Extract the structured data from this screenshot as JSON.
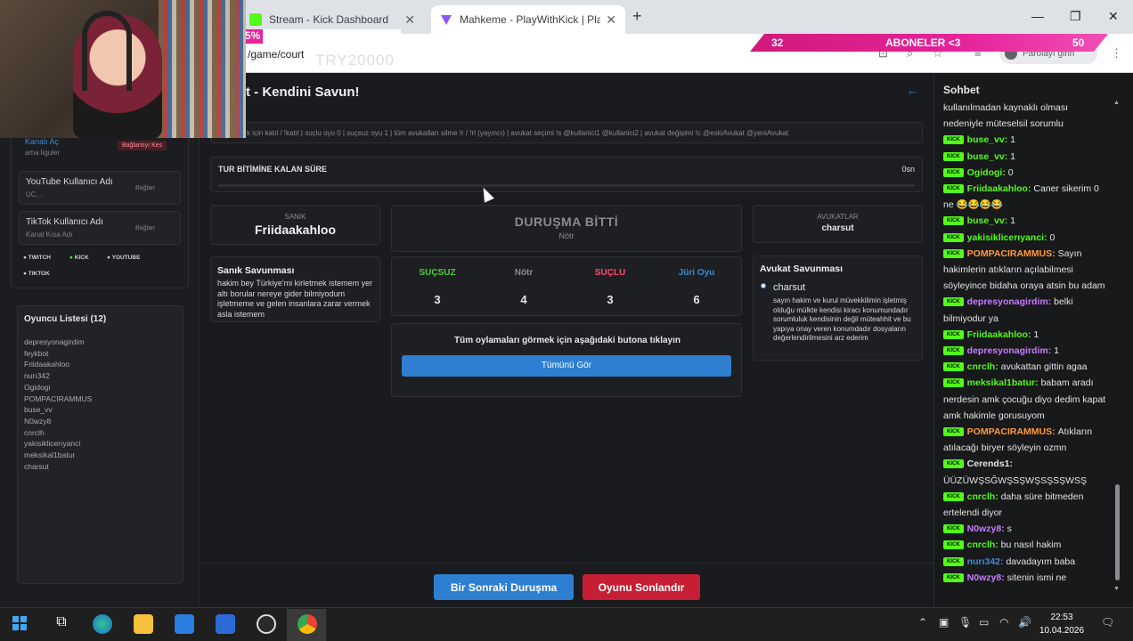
{
  "browser": {
    "tabs": [
      {
        "title": "Stream - Kick Dashboard",
        "active": false
      },
      {
        "title": "Mahkeme - PlayWithKick | Play",
        "active": true
      }
    ],
    "url": "/game/court",
    "profile_label": "Parolayı girin"
  },
  "overlay": {
    "goal_left": "32",
    "goal_text": "ABONELER <3",
    "goal_right": "50",
    "percent": "5%",
    "code": "TRY20000"
  },
  "left": {
    "open_channel": "Kanalı Aç",
    "open_channel_sub": "ama liguler",
    "disconnect_label": "Bağlantıyı Kes",
    "youtube_label": "YouTube Kullanıcı Adı",
    "youtube_placeholder": "UC...",
    "youtube_connect": "Bağlan",
    "tiktok_label": "TikTok Kullanıcı Adı",
    "tiktok_placeholder": "Kanal Kısa Adı",
    "tiktok_connect": "Bağlan",
    "platforms": [
      "TWITCH",
      "KICK",
      "YOUTUBE",
      "TIKTOK"
    ],
    "players_title": "Oyuncu Listesi (12)",
    "players": [
      "depresyonagirdim",
      "feykbot",
      "Friidaakahloo",
      "nurı342",
      "Ogidogi",
      "POMPACIRAMMUS",
      "buse_vv",
      "N0wzy8",
      "cnrclh",
      "yakisiklicerıyanci",
      "meksikal1batur",
      "charsut"
    ]
  },
  "main": {
    "title": "t - Kendini Savun!",
    "commands": "k için katıl / !katıl | suçlu oyu 0 | suçsuz oyu 1 | tüm avukatları silme !r / !rl (yayıncı) | avukat seçimi !s @kullanici1 @kullanici2 | avukat değişimi !c @eskiAvukat @yeniAvukat",
    "timer_label": "TUR BİTİMİNE KALAN SÜRE",
    "timer_value": "0sn",
    "timer_progress": 0,
    "defendant_label": "SANIK",
    "defendant_name": "Friidaakahloo",
    "trial_status": "DURUŞMA BİTTİ",
    "trial_result": "Nötr",
    "lawyers_label": "AVUKATLAR",
    "lawyer_name": "charsut",
    "defendant_defense_title": "Sanık Savunması",
    "defendant_defense_text": "hakim bey Türkiye'mi kirletmek istemem yer altı borular nereye gider bilmiyodum işletmeme ve gelen insanlara zarar vermek asla istemem",
    "votes": [
      {
        "label": "SUÇSUZ",
        "value": "3",
        "color": "#4ccd3c"
      },
      {
        "label": "Nötr",
        "value": "4",
        "color": "#8a8c91"
      },
      {
        "label": "SUÇLU",
        "value": "3",
        "color": "#ff4d6d"
      },
      {
        "label": "Jüri Oyu",
        "value": "6",
        "color": "#3b8bd6"
      }
    ],
    "see_all_text": "Tüm oylamaları görmek için aşağıdaki butona tıklayın",
    "see_all_button": "Tümünü Gör",
    "lawyer_defense_title": "Avukat Savunması",
    "lawyer_defense_name": "charsut",
    "lawyer_defense_text": "sayın hakim ve kurul müvekkilimin işletmiş olduğu mülkte kendisi kiracı konumundadır sorumluluk kendisinin değil müteahhit ve bu yapıya onay veren konumdadır dosyaların değerlendirilmesini arz ederim",
    "next_button": "Bir Sonraki Duruşma",
    "end_button": "Oyunu Sonlandır"
  },
  "chat": {
    "title": "Sohbet",
    "messages": [
      {
        "user": "",
        "text": "kullanılmadan kaynaklı olması nedeniyle müteselsil sorumlu",
        "color": "#e4e4e4",
        "badge": false
      },
      {
        "user": "buse_vv",
        "text": "1",
        "color": "#53fc18",
        "badge": true
      },
      {
        "user": "buse_vv",
        "text": "1",
        "color": "#53fc18",
        "badge": true
      },
      {
        "user": "Ogidogi",
        "text": "0",
        "color": "#53fc18",
        "badge": true
      },
      {
        "user": "Friidaakahloo",
        "text": "Caner sikerim 0 ne 😂😂😂😂",
        "color": "#53fc18",
        "badge": true
      },
      {
        "user": "buse_vv",
        "text": "1",
        "color": "#53fc18",
        "badge": true
      },
      {
        "user": "yakisiklicerıyanci",
        "text": "0",
        "color": "#53fc18",
        "badge": true
      },
      {
        "user": "POMPACIRAMMUS",
        "text": "Sayın hakimlerin atıkların açılabilmesi söyleyince bidaha oraya atsin bu adam",
        "color": "#ff9a3c",
        "badge": true
      },
      {
        "user": "depresyonagirdim",
        "text": "belki bilmiyodur ya",
        "color": "#c77dff",
        "badge": true
      },
      {
        "user": "Friidaakahloo",
        "text": "1",
        "color": "#53fc18",
        "badge": true
      },
      {
        "user": "depresyonagirdim",
        "text": "1",
        "color": "#c77dff",
        "badge": true
      },
      {
        "user": "cnrclh",
        "text": "avukattan gittin agaa",
        "color": "#53fc18",
        "badge": true
      },
      {
        "user": "meksikal1batur",
        "text": "babam aradı nerdesin amk çocuğu diyo dedim kapat amk hakimle gorusuyom",
        "color": "#53fc18",
        "badge": true
      },
      {
        "user": "POMPACIRAMMUS",
        "text": "Atıkların atılacağı biryer söyleyin ozmn",
        "color": "#ff9a3c",
        "badge": true
      },
      {
        "user": "Cerends1",
        "text": "ÜÜZÜWŞSĞWŞSŞWŞSŞSŞWSŞ",
        "color": "#e4e4e4",
        "badge": true
      },
      {
        "user": "cnrclh",
        "text": "daha süre bitmeden ertelendi diyor",
        "color": "#53fc18",
        "badge": true
      },
      {
        "user": "N0wzy8",
        "text": "s",
        "color": "#c77dff",
        "badge": true
      },
      {
        "user": "cnrclh",
        "text": "bu nasıl hakim",
        "color": "#53fc18",
        "badge": true
      },
      {
        "user": "nurı342",
        "text": "davadayım baba",
        "color": "#3b8bd6",
        "badge": true
      },
      {
        "user": "N0wzy8",
        "text": "sitenin ismi ne",
        "color": "#c77dff",
        "badge": true
      }
    ]
  },
  "taskbar": {
    "time": "22:53",
    "date": "10.04.2026"
  }
}
